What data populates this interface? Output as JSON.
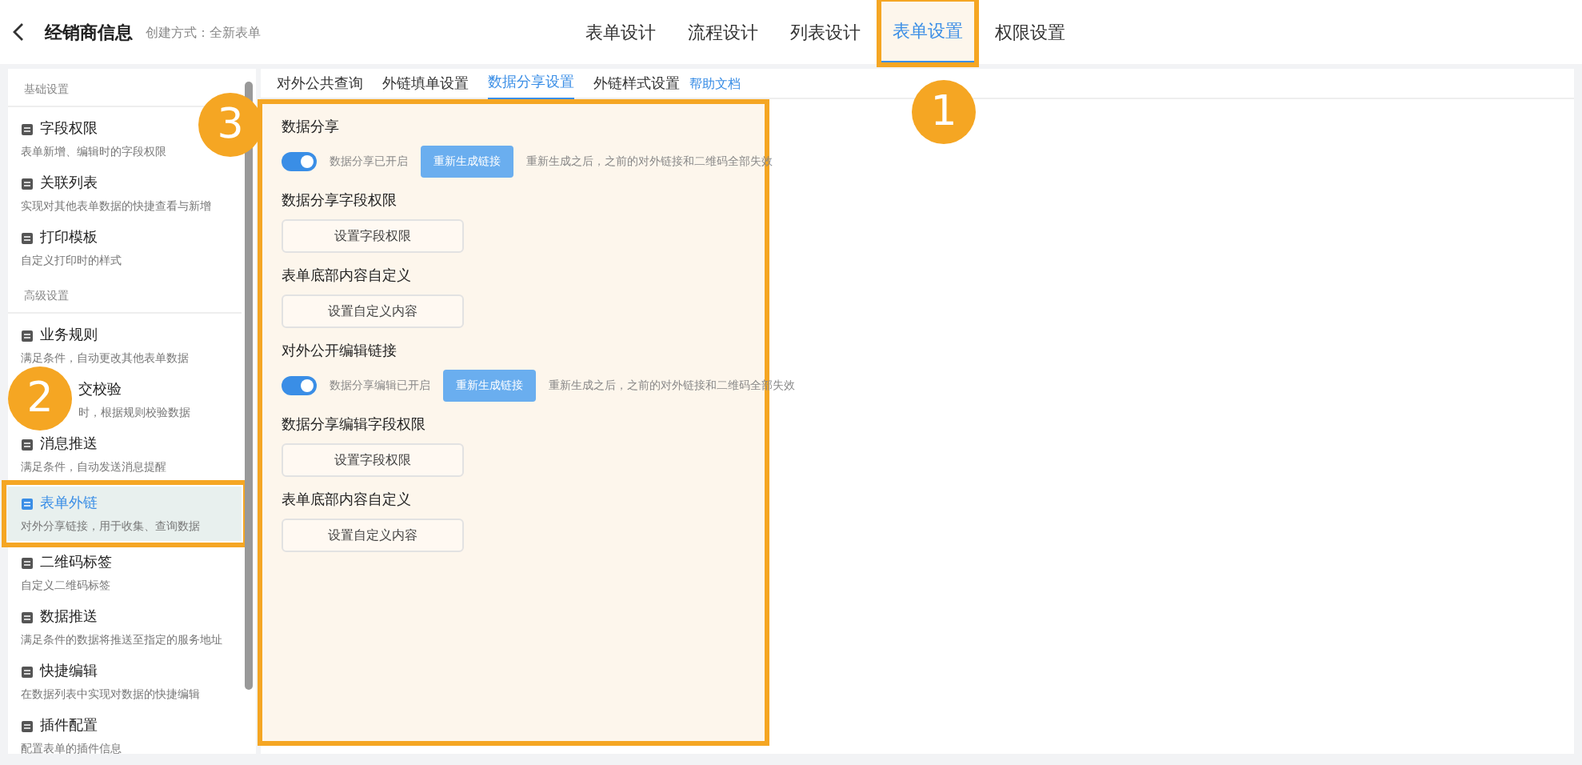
{
  "header": {
    "title": "经销商信息",
    "subtitle": "创建方式：全新表单"
  },
  "tabs": [
    {
      "label": "表单设计",
      "selected": false,
      "highlighted": false
    },
    {
      "label": "流程设计",
      "selected": false,
      "highlighted": false
    },
    {
      "label": "列表设计",
      "selected": false,
      "highlighted": false
    },
    {
      "label": "表单设置",
      "selected": true,
      "highlighted": true
    },
    {
      "label": "权限设置",
      "selected": false,
      "highlighted": false
    }
  ],
  "sidebar": {
    "sections": [
      {
        "header": "基础设置",
        "items": [
          {
            "title": "字段权限",
            "desc": "表单新增、编辑时的字段权限",
            "selected": false,
            "highlighted": false,
            "covered": false
          },
          {
            "title": "关联列表",
            "desc": "实现对其他表单数据的快捷查看与新增",
            "selected": false,
            "highlighted": false,
            "covered": false
          },
          {
            "title": "打印模板",
            "desc": "自定义打印时的样式",
            "selected": false,
            "highlighted": false,
            "covered": false
          }
        ]
      },
      {
        "header": "高级设置",
        "items": [
          {
            "title": "业务规则",
            "desc": "满足条件，自动更改其他表单数据",
            "selected": false,
            "highlighted": false,
            "covered": false
          },
          {
            "title": "交校验",
            "desc": "时，根据规则校验数据",
            "selected": false,
            "highlighted": false,
            "covered": true
          },
          {
            "title": "消息推送",
            "desc": "满足条件，自动发送消息提醒",
            "selected": false,
            "highlighted": false,
            "covered": false
          },
          {
            "title": "表单外链",
            "desc": "对外分享链接，用于收集、查询数据",
            "selected": true,
            "highlighted": true,
            "covered": false
          },
          {
            "title": "二维码标签",
            "desc": "自定义二维码标签",
            "selected": false,
            "highlighted": false,
            "covered": false
          },
          {
            "title": "数据推送",
            "desc": "满足条件的数据将推送至指定的服务地址",
            "selected": false,
            "highlighted": false,
            "covered": false
          },
          {
            "title": "快捷编辑",
            "desc": "在数据列表中实现对数据的快捷编辑",
            "selected": false,
            "highlighted": false,
            "covered": false
          },
          {
            "title": "插件配置",
            "desc": "配置表单的插件信息",
            "selected": false,
            "highlighted": false,
            "covered": false
          }
        ]
      }
    ]
  },
  "subtabs": [
    {
      "label": "对外公共查询",
      "selected": false
    },
    {
      "label": "外链填单设置",
      "selected": false
    },
    {
      "label": "数据分享设置",
      "selected": true
    },
    {
      "label": "外链样式设置",
      "selected": false
    }
  ],
  "help_link": "帮助文档",
  "content": {
    "highlighted": true,
    "blocks": [
      {
        "kind": "toggle",
        "title": "数据分享",
        "on": true,
        "status": "数据分享已开启",
        "button": "重新生成链接",
        "hint": "重新生成之后，之前的对外链接和二维码全部失效"
      },
      {
        "kind": "button",
        "title": "数据分享字段权限",
        "button": "设置字段权限"
      },
      {
        "kind": "button",
        "title": "表单底部内容自定义",
        "button": "设置自定义内容"
      },
      {
        "kind": "toggle",
        "title": "对外公开编辑链接",
        "on": true,
        "status": "数据分享编辑已开启",
        "button": "重新生成链接",
        "hint": "重新生成之后，之前的对外链接和二维码全部失效"
      },
      {
        "kind": "button",
        "title": "数据分享编辑字段权限",
        "button": "设置字段权限"
      },
      {
        "kind": "button",
        "title": "表单底部内容自定义",
        "button": "设置自定义内容"
      }
    ]
  },
  "callouts": [
    {
      "label": "1"
    },
    {
      "label": "2"
    },
    {
      "label": "3"
    }
  ]
}
